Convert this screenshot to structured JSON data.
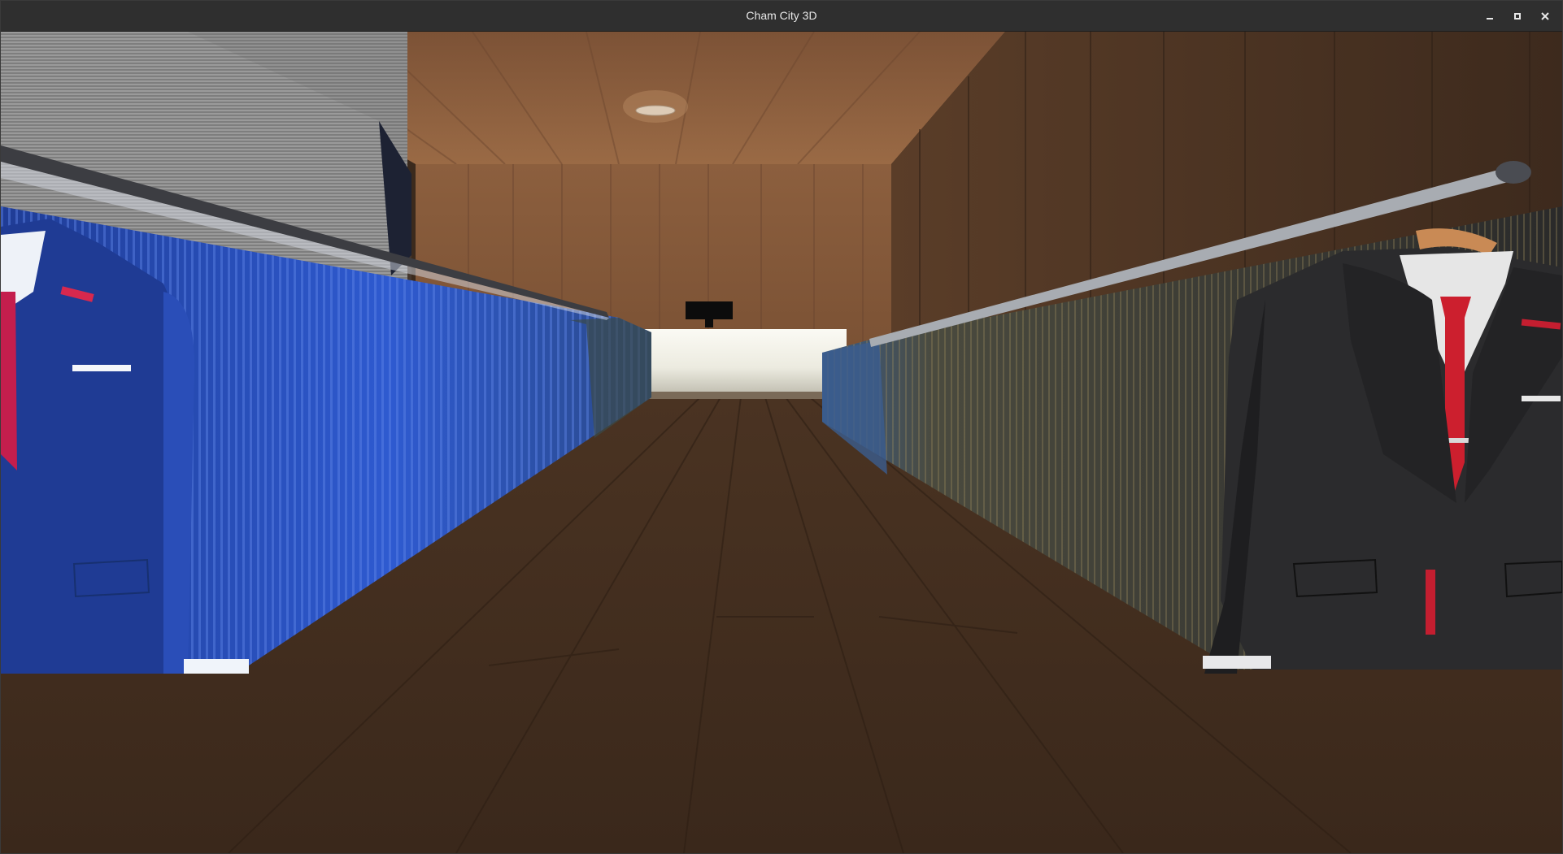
{
  "window": {
    "title": "Cham City 3D",
    "controls": [
      {
        "name": "minimize-button",
        "icon": "minimize-icon"
      },
      {
        "name": "maximize-button",
        "icon": "maximize-icon"
      },
      {
        "name": "close-button",
        "icon": "close-icon"
      }
    ]
  },
  "scene": {
    "type": "3d-viewport",
    "description_objects": [
      "ceiling",
      "back-wall",
      "right-wall",
      "floor",
      "checkout-counter",
      "ceiling-light",
      "left-suit-rack",
      "right-suit-rack"
    ],
    "colors": {
      "ceiling": "#8a5a3a",
      "wall": "#7a5236",
      "right_wall": "#4a3222",
      "floor": "#3e2a1c",
      "counter": "#e8e6dc",
      "left_suits": "#2d4fb0",
      "right_suits": "#2a2a2a",
      "tie": "#c0222f",
      "shirt": "#e4e6ea",
      "rail": "#7d8088"
    }
  }
}
